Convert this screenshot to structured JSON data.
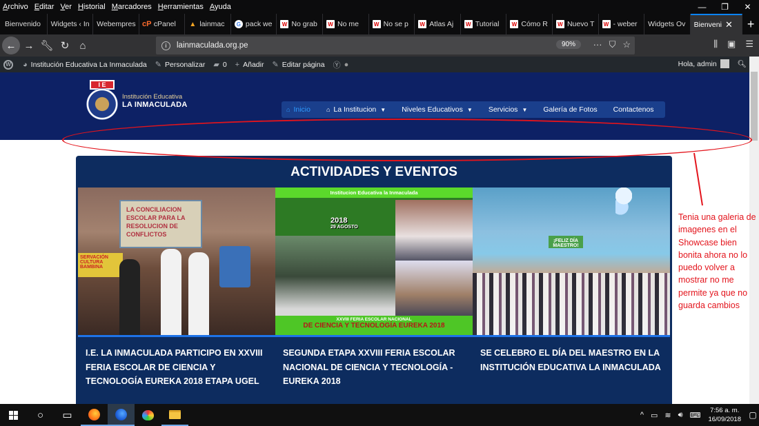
{
  "menubar": {
    "items": [
      "Archivo",
      "Editar",
      "Ver",
      "Historial",
      "Marcadores",
      "Herramientas",
      "Ayuda"
    ]
  },
  "window_controls": {
    "minimize": "—",
    "restore": "❐",
    "close": "✕"
  },
  "tabs": [
    {
      "label": "Bienvenido",
      "favicon": "none"
    },
    {
      "label": "Widgets ‹ In",
      "favicon": "none"
    },
    {
      "label": "Webempres",
      "favicon": "none"
    },
    {
      "label": "cPanel",
      "favicon": "cpanel"
    },
    {
      "label": "lainmac",
      "favicon": "lainmac"
    },
    {
      "label": "pack we",
      "favicon": "google"
    },
    {
      "label": "No grab",
      "favicon": "w"
    },
    {
      "label": "No me",
      "favicon": "w"
    },
    {
      "label": "No se p",
      "favicon": "w"
    },
    {
      "label": "Atlas Aj",
      "favicon": "w"
    },
    {
      "label": "Tutorial",
      "favicon": "w"
    },
    {
      "label": "Cómo R",
      "favicon": "w"
    },
    {
      "label": "Nuevo T",
      "favicon": "w"
    },
    {
      "label": "- weber",
      "favicon": "w"
    },
    {
      "label": "Widgets Ov",
      "favicon": "none"
    },
    {
      "label": "Bienveni",
      "favicon": "none",
      "active": true
    }
  ],
  "tab_close": "✕",
  "new_tab": "+",
  "nav": {
    "url": "lainmaculada.org.pe",
    "zoom": "90%",
    "more": "···"
  },
  "wp_admin": {
    "site_name": "Institución Educativa La Inmaculada",
    "customize": "Personalizar",
    "comments": "0",
    "add_new": "Añadir",
    "edit_page": "Editar página",
    "greeting": "Hola, admin"
  },
  "site": {
    "logo_letters": "I E",
    "brand_line1": "Institución Educativa",
    "brand_line2": "LA INMACULADA",
    "menu": [
      {
        "label": "Inicio",
        "icon": "home-icon",
        "active": true
      },
      {
        "label": "La Institucion",
        "icon": "home-icon",
        "dropdown": true
      },
      {
        "label": "Niveles Educativos",
        "dropdown": true
      },
      {
        "label": "Servicios",
        "dropdown": true
      },
      {
        "label": "Galería de Fotos"
      },
      {
        "label": "Contactenos"
      }
    ],
    "section_title": "ACTIVIDADES Y EVENTOS",
    "image1": {
      "poster_text": "LA CONCILIACION ESCOLAR PARA LA RESOLUCION DE CONFLICTOS",
      "side_text": "SERVACIÓN CULTURA BAMBINA"
    },
    "image2": {
      "header": "Institucion Educativa la Inmaculada",
      "year": "2018",
      "date": "29 AGOSTO",
      "footer_small": "XXVIII FERIA ESCOLAR NACIONAL",
      "footer": "DE CIENCIA Y TECNOLOGÍA EUREKA 2018"
    },
    "image3": {
      "banner": "¡FELIZ DÍA MAESTRO!"
    },
    "captions": [
      "I.E. LA INMACULADA PARTICIPO EN XXVIII FERIA ESCOLAR DE CIENCIA Y TECNOLOGÍA EUREKA 2018 ETAPA UGEL",
      "SEGUNDA ETAPA XXVIII FERIA ESCOLAR NACIONAL DE CIENCIA Y TECNOLOGÍA - EUREKA 2018",
      "SE CELEBRO EL DÍA DEL MAESTRO EN LA INSTITUCIÓN EDUCATIVA LA INMACULADA"
    ]
  },
  "annotation_note": "Tenia una galeria de imagenes en el Showcase bien bonita ahora no lo puedo volver a mostrar no me permite ya que no guarda cambios",
  "annotation_color": "#e3141c",
  "taskbar": {
    "time": "7:56 a. m.",
    "date": "16/09/2018"
  }
}
